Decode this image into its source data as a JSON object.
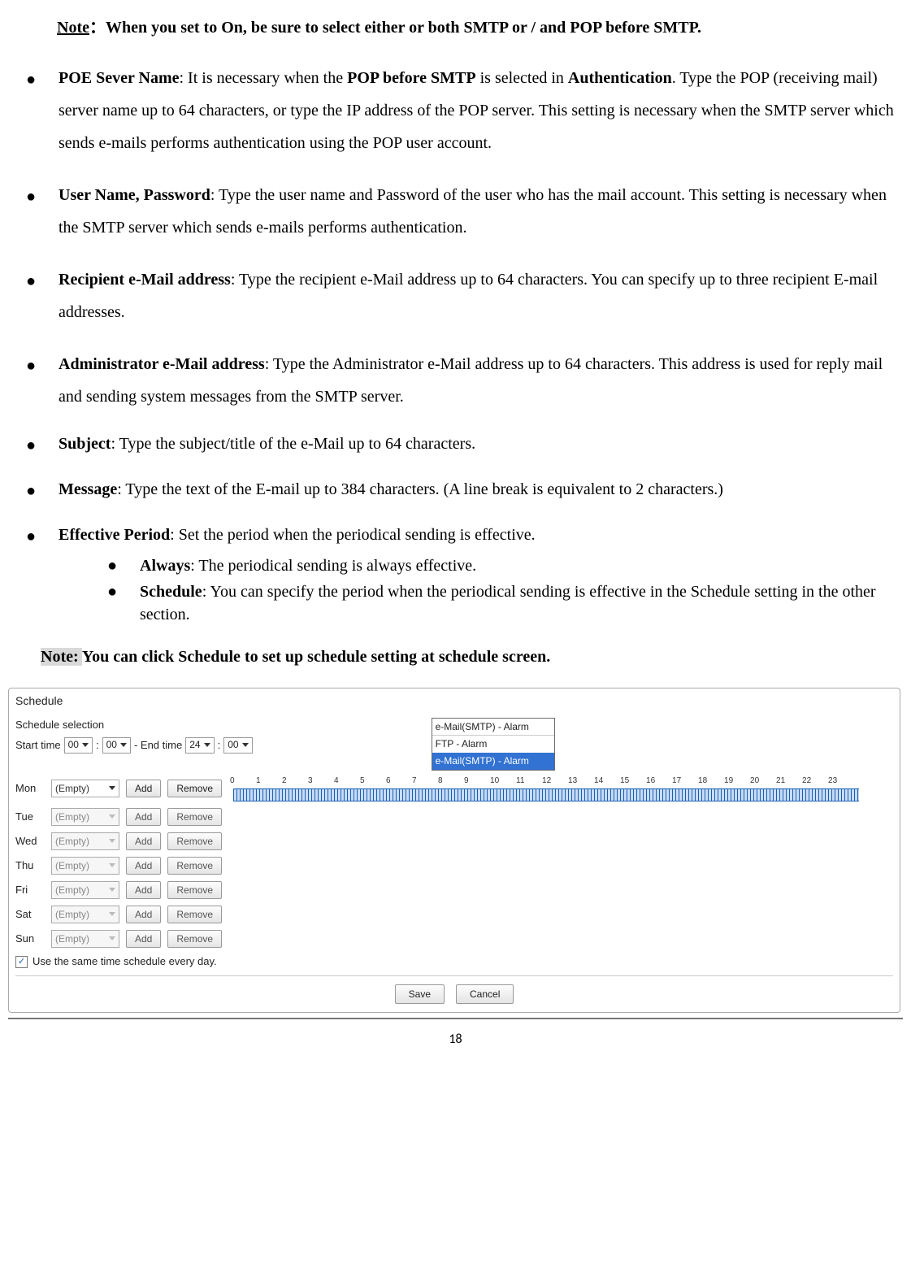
{
  "topNote": {
    "prefix": "Note",
    "sep": "：",
    "text": "When you set to On, be sure to select either or both SMTP or / and POP before SMTP."
  },
  "bullets": {
    "poe": {
      "label": "POE Sever Name",
      "t1": ": It is necessary when the ",
      "b1": "POP before SMTP",
      "t2": " is selected in ",
      "b2": "Authentication",
      "t3": ". Type the POP (receiving mail) server name up to 64 characters, or type the IP address of the POP server. This setting is necessary when the SMTP server which sends e-mails performs authentication using the POP user account."
    },
    "user": {
      "label": "User Name, Password",
      "text": ": Type the user name and Password of the user who has the mail account. This setting is necessary when the SMTP server which sends e-mails performs authentication."
    },
    "recip": {
      "label": "Recipient e-Mail address",
      "text": ": Type the recipient e-Mail address up to 64 characters. You can specify up to three recipient E-mail addresses."
    },
    "admin": {
      "label": "Administrator e-Mail address",
      "text": ": Type the Administrator e-Mail address up to 64 characters. This address is used for reply mail and sending system messages from the SMTP server."
    },
    "subject": {
      "label": "Subject",
      "text": ": Type the subject/title of the e-Mail up to 64 characters."
    },
    "message": {
      "label": "Message",
      "text": ": Type the text of the E-mail up to 384 characters. (A line break is equivalent to 2 characters.)"
    },
    "effective": {
      "label": "Effective Period",
      "text": ": Set the period when the periodical sending is effective.",
      "sub": {
        "always": {
          "label": "Always",
          "text": ": The periodical sending is always effective."
        },
        "schedule": {
          "label": "Schedule",
          "text": ": You can specify the period when the periodical sending is effective in the Schedule setting in the other section."
        }
      }
    }
  },
  "note2": {
    "hl": "Note: ",
    "t1": "You can click ",
    "b1": "Schedule",
    "t2": " to set up schedule setting at schedule screen."
  },
  "schedule": {
    "title": "Schedule",
    "selectionLabel": "Schedule selection",
    "startLabel": "Start time",
    "endLabel": "- End time",
    "colon": ":",
    "start_h": "00",
    "start_m": "00",
    "end_h": "24",
    "end_m": "00",
    "dropdown": {
      "head": "e-Mail(SMTP) - Alarm",
      "items": [
        "FTP - Alarm",
        "e-Mail(SMTP) - Alarm"
      ],
      "selectedIndex": 1
    },
    "hours": [
      "0",
      "1",
      "2",
      "3",
      "4",
      "5",
      "6",
      "7",
      "8",
      "9",
      "10",
      "11",
      "12",
      "13",
      "14",
      "15",
      "16",
      "17",
      "18",
      "19",
      "20",
      "21",
      "22",
      "23"
    ],
    "days": [
      {
        "label": "Mon",
        "value": "(Empty)",
        "enabled": true
      },
      {
        "label": "Tue",
        "value": "(Empty)",
        "enabled": false
      },
      {
        "label": "Wed",
        "value": "(Empty)",
        "enabled": false
      },
      {
        "label": "Thu",
        "value": "(Empty)",
        "enabled": false
      },
      {
        "label": "Fri",
        "value": "(Empty)",
        "enabled": false
      },
      {
        "label": "Sat",
        "value": "(Empty)",
        "enabled": false
      },
      {
        "label": "Sun",
        "value": "(Empty)",
        "enabled": false
      }
    ],
    "addLabel": "Add",
    "removeLabel": "Remove",
    "sameTimeLabel": "Use the same time schedule every day.",
    "sameTimeChecked": true,
    "saveLabel": "Save",
    "cancelLabel": "Cancel"
  },
  "pageNumber": "18"
}
